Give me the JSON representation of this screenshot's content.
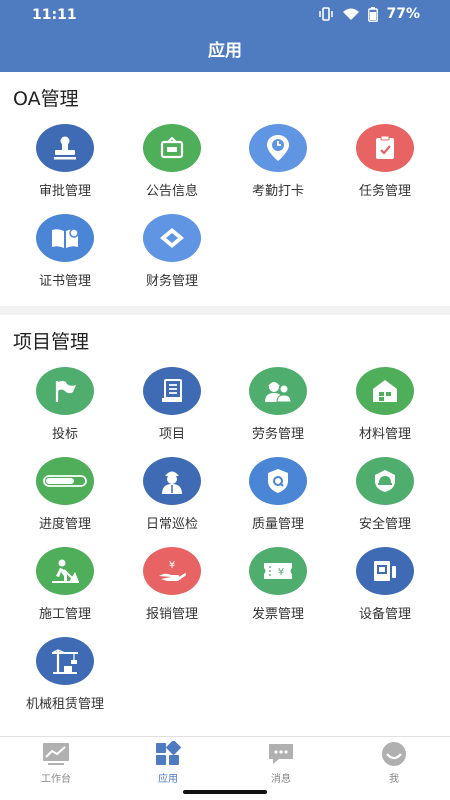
{
  "status": {
    "time": "11:11",
    "battery": "77%"
  },
  "appbar": {
    "title": "应用"
  },
  "sections": [
    {
      "title": "OA管理",
      "items": [
        {
          "label": "审批管理",
          "icon": "stamp-icon",
          "color": "#3f6bb5"
        },
        {
          "label": "公告信息",
          "icon": "notice-icon",
          "color": "#4fae5a"
        },
        {
          "label": "考勤打卡",
          "icon": "clock-pin-icon",
          "color": "#5f95e3"
        },
        {
          "label": "任务管理",
          "icon": "task-clipboard-icon",
          "color": "#e86464"
        },
        {
          "label": "证书管理",
          "icon": "certificate-book-icon",
          "color": "#4b85d6"
        },
        {
          "label": "财务管理",
          "icon": "finance-diamond-icon",
          "color": "#5f95e3"
        }
      ]
    },
    {
      "title": "项目管理",
      "items": [
        {
          "label": "投标",
          "icon": "flag-icon",
          "color": "#4fae6e"
        },
        {
          "label": "项目",
          "icon": "project-doc-icon",
          "color": "#3f6bb5"
        },
        {
          "label": "劳务管理",
          "icon": "workers-icon",
          "color": "#4fae6e"
        },
        {
          "label": "材料管理",
          "icon": "warehouse-icon",
          "color": "#4fae5a"
        },
        {
          "label": "进度管理",
          "icon": "progress-bar-icon",
          "color": "#4fae5a"
        },
        {
          "label": "日常巡检",
          "icon": "inspector-icon",
          "color": "#3f6bb5"
        },
        {
          "label": "质量管理",
          "icon": "quality-shield-icon",
          "color": "#4b85d6"
        },
        {
          "label": "安全管理",
          "icon": "safety-helmet-icon",
          "color": "#4fae6e"
        },
        {
          "label": "施工管理",
          "icon": "construction-worker-icon",
          "color": "#4fae5a"
        },
        {
          "label": "报销管理",
          "icon": "reimburse-hand-icon",
          "color": "#e86464"
        },
        {
          "label": "发票管理",
          "icon": "invoice-ticket-icon",
          "color": "#4fae6e"
        },
        {
          "label": "设备管理",
          "icon": "equipment-device-icon",
          "color": "#3f6bb5"
        },
        {
          "label": "机械租赁管理",
          "icon": "crane-icon",
          "color": "#3f6bb5"
        }
      ]
    }
  ],
  "tabs": [
    {
      "label": "工作台",
      "icon": "workbench-chart-icon",
      "active": false
    },
    {
      "label": "应用",
      "icon": "apps-grid-icon",
      "active": true
    },
    {
      "label": "消息",
      "icon": "message-bubble-icon",
      "active": false
    },
    {
      "label": "我",
      "icon": "profile-face-icon",
      "active": false
    }
  ],
  "colors": {
    "primary": "#4f7cc0",
    "inactive_tab": "#b0b0b0"
  }
}
